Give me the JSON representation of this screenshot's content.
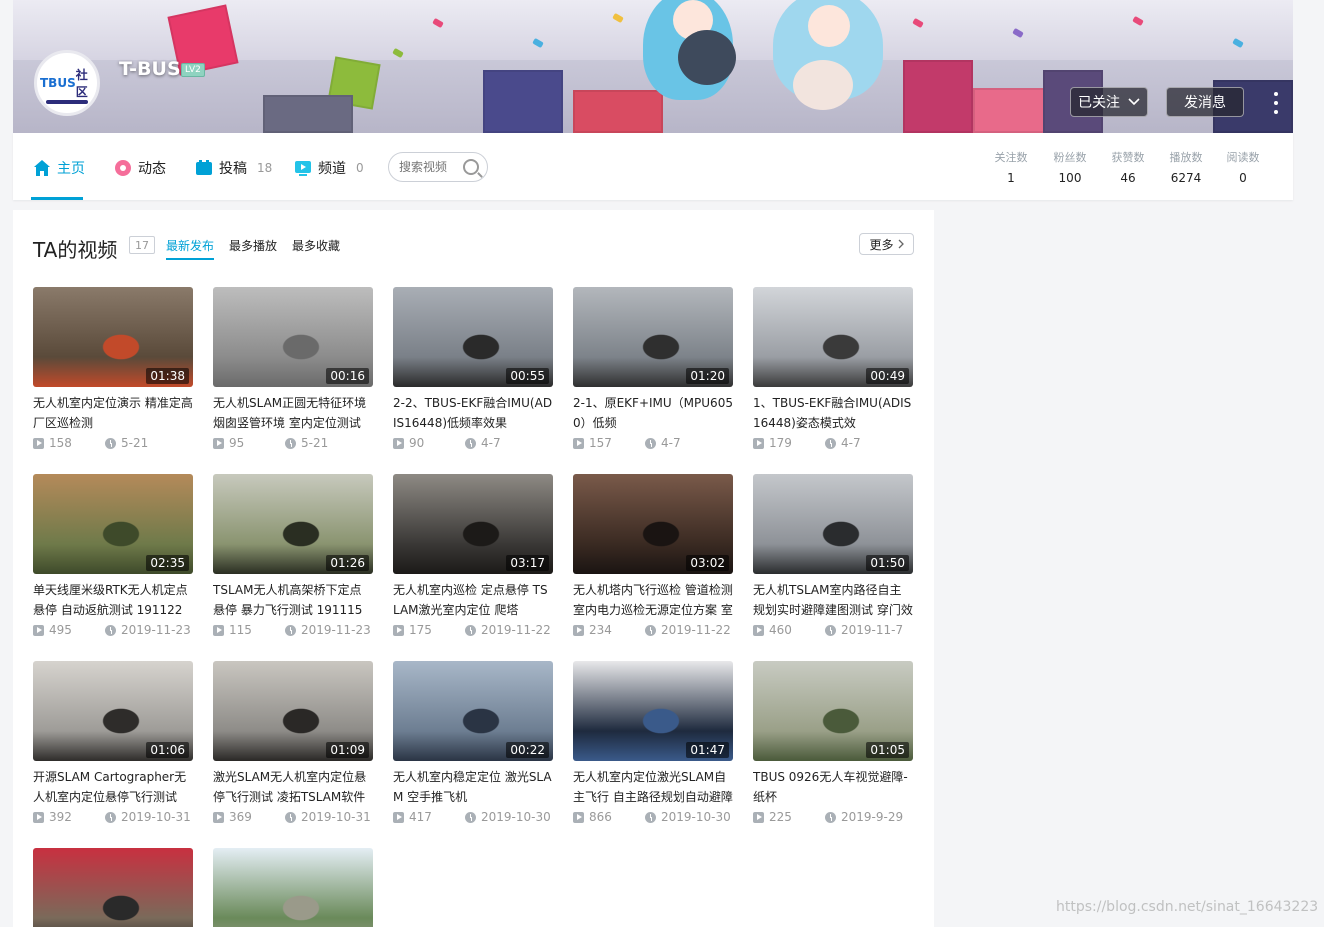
{
  "profile": {
    "username": "T-BUS",
    "level": "LV2",
    "avatar_text_a": "TBUS",
    "avatar_text_b": "社区",
    "follow_label": "已关注",
    "message_label": "发消息"
  },
  "nav": {
    "items": [
      {
        "label": "主页",
        "count": ""
      },
      {
        "label": "动态",
        "count": ""
      },
      {
        "label": "投稿",
        "count": "18"
      },
      {
        "label": "频道",
        "count": "0"
      }
    ],
    "search_placeholder": "搜索视频"
  },
  "stats": [
    {
      "label": "关注数",
      "value": "1"
    },
    {
      "label": "粉丝数",
      "value": "100"
    },
    {
      "label": "获赞数",
      "value": "46"
    },
    {
      "label": "播放数",
      "value": "6274"
    },
    {
      "label": "阅读数",
      "value": "0"
    }
  ],
  "videos_section": {
    "title": "TA的视频",
    "count": "17",
    "tabs": [
      "最新发布",
      "最多播放",
      "最多收藏"
    ],
    "more_label": "更多"
  },
  "videos": [
    {
      "title": "无人机室内定位演示 精准定高 厂区巡检测",
      "duration": "01:38",
      "plays": "158",
      "date": "5-21",
      "thumb_colors": [
        "#5a4a3a",
        "#8a7a6a",
        "#c24a2a"
      ]
    },
    {
      "title": "无人机SLAM正圆无特征环境 烟囱竖管环境 室内定位测试",
      "duration": "00:16",
      "plays": "95",
      "date": "5-21",
      "thumb_colors": [
        "#8c8c8c",
        "#bdbdbd",
        "#6a6a6a"
      ]
    },
    {
      "title": "2-2、TBUS-EKF融合IMU(ADIS16448)低频率效果",
      "duration": "00:55",
      "plays": "90",
      "date": "4-7",
      "thumb_colors": [
        "#7a8088",
        "#a9aeb5",
        "#2a2a2a"
      ]
    },
    {
      "title": "2-1、原EKF+IMU（MPU6050）低频",
      "duration": "01:20",
      "plays": "157",
      "date": "4-7",
      "thumb_colors": [
        "#7d838a",
        "#b3b7bc",
        "#2f2f2f"
      ]
    },
    {
      "title": "1、TBUS-EKF融合IMU(ADIS16448)姿态模式效",
      "duration": "00:49",
      "plays": "179",
      "date": "4-7",
      "thumb_colors": [
        "#9a9ea4",
        "#d2d5d9",
        "#3a3a3a"
      ]
    },
    {
      "title": "单天线厘米级RTK无人机定点悬停 自动返航测试 191122",
      "duration": "02:35",
      "plays": "495",
      "date": "2019-11-23",
      "thumb_colors": [
        "#6f7a4a",
        "#b58a5a",
        "#3e4a2a"
      ]
    },
    {
      "title": "TSLAM无人机高架桥下定点悬停 暴力飞行测试 191115",
      "duration": "01:26",
      "plays": "115",
      "date": "2019-11-23",
      "thumb_colors": [
        "#8a9470",
        "#c7c9bd",
        "#2a2e22"
      ]
    },
    {
      "title": "无人机室内巡检 定点悬停 TSLAM激光室内定位 爬塔",
      "duration": "03:17",
      "plays": "175",
      "date": "2019-11-22",
      "thumb_colors": [
        "#3a3836",
        "#8e8a84",
        "#1c1a18"
      ]
    },
    {
      "title": "无人机塔内飞行巡检 管道检测 室内电力巡检无源定位方案 室",
      "duration": "03:02",
      "plays": "234",
      "date": "2019-11-22",
      "thumb_colors": [
        "#3a2a22",
        "#7a5a4a",
        "#1a1412"
      ]
    },
    {
      "title": "无人机TSLAM室内路径自主规划实时避障建图测试 穿门效",
      "duration": "01:50",
      "plays": "460",
      "date": "2019-11-7",
      "thumb_colors": [
        "#8e9298",
        "#c4c7cb",
        "#2a2c2e"
      ]
    },
    {
      "title": "开源SLAM Cartographer无人机室内定位悬停飞行测试",
      "duration": "01:06",
      "plays": "392",
      "date": "2019-10-31",
      "thumb_colors": [
        "#9e9c98",
        "#d6d3ce",
        "#2e2c2a"
      ]
    },
    {
      "title": "激光SLAM无人机室内定位悬停飞行测试 凌拓TSLAM软件",
      "duration": "01:09",
      "plays": "369",
      "date": "2019-10-31",
      "thumb_colors": [
        "#8e8c88",
        "#c9c6c0",
        "#2a2826"
      ]
    },
    {
      "title": "无人机室内稳定定位 激光SLAM 空手推飞机",
      "duration": "00:22",
      "plays": "417",
      "date": "2019-10-30",
      "thumb_colors": [
        "#6d7e92",
        "#a8b7c8",
        "#2a3444"
      ]
    },
    {
      "title": "无人机室内定位激光SLAM自主飞行 自主路径规划自动避障",
      "duration": "01:47",
      "plays": "866",
      "date": "2019-10-30",
      "thumb_colors": [
        "#1e2a3e",
        "#e8e8ea",
        "#3a5a8a"
      ]
    },
    {
      "title": "TBUS 0926无人车视觉避障-纸杯",
      "duration": "01:05",
      "plays": "225",
      "date": "2019-9-29",
      "thumb_colors": [
        "#9aa088",
        "#c8cbc2",
        "#4a5a3a"
      ]
    },
    {
      "title": "",
      "duration": "",
      "plays": "",
      "date": "",
      "thumb_colors": [
        "#7a6a5a",
        "#c83040",
        "#2a2a2a"
      ]
    },
    {
      "title": "",
      "duration": "",
      "plays": "",
      "date": "",
      "thumb_colors": [
        "#6a8a5a",
        "#e4eef4",
        "#9a9a8a"
      ]
    }
  ],
  "watermark": "https://blog.csdn.net/sinat_16643223",
  "colors": {
    "accent": "#00a1d6",
    "muted": "#99a2aa",
    "background": "#f4f5f7"
  }
}
